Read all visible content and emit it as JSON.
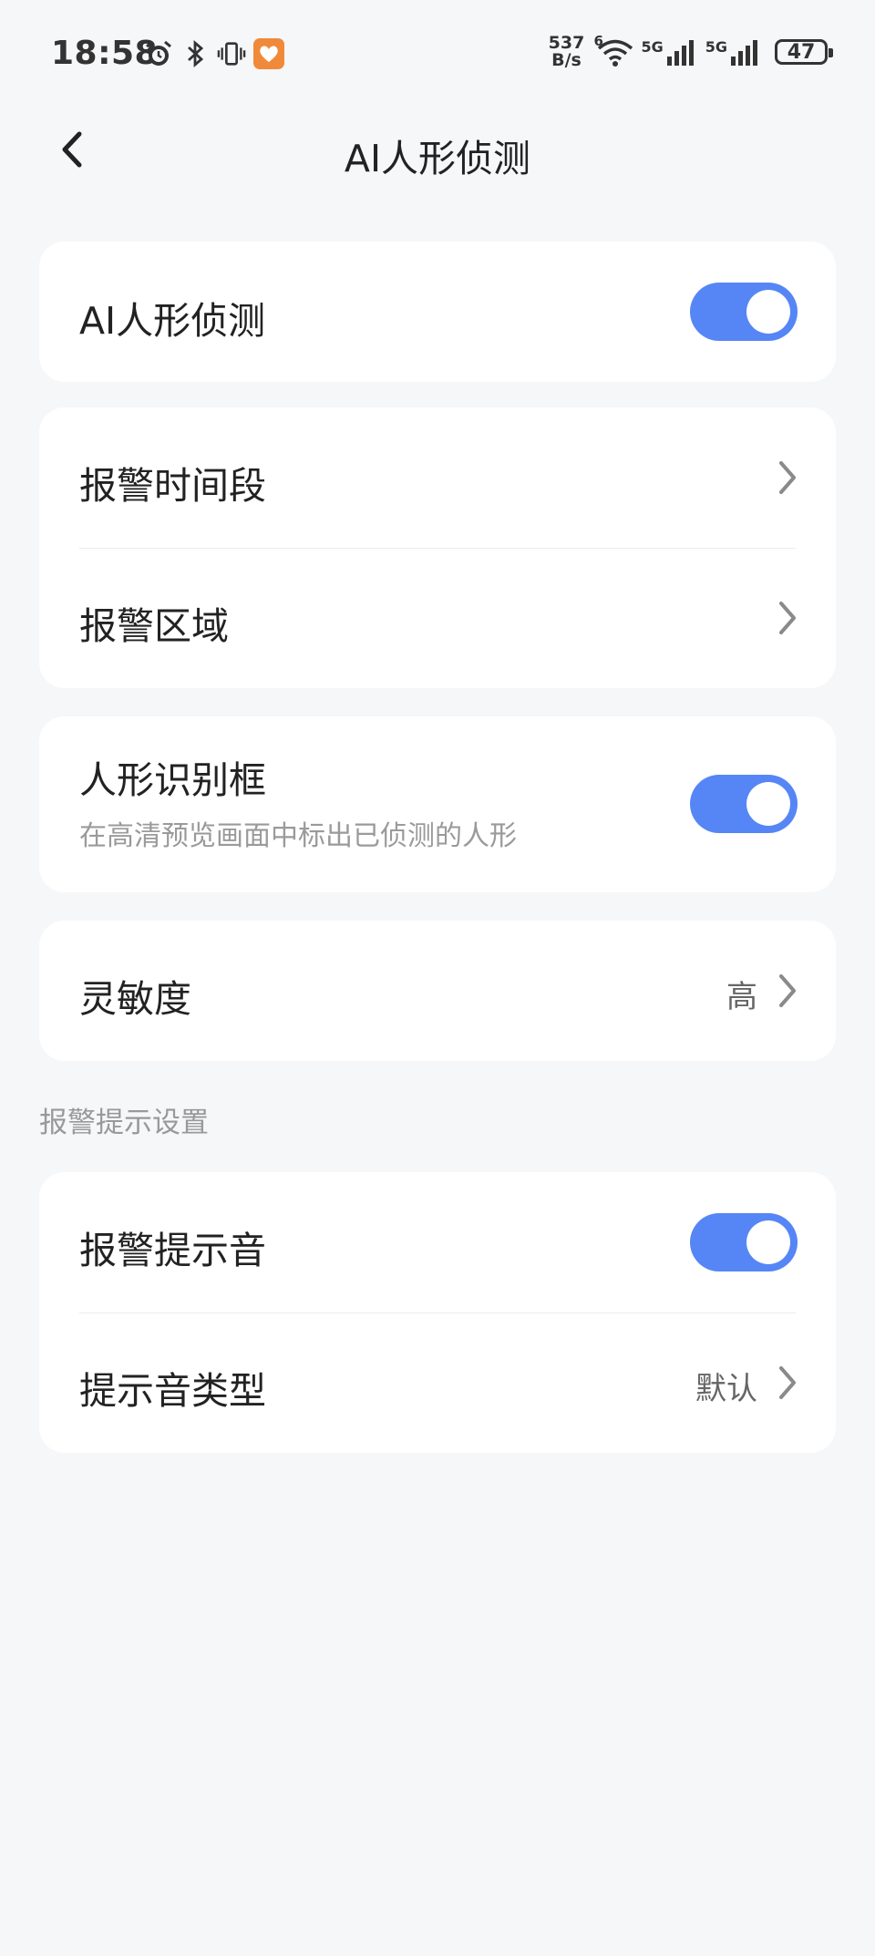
{
  "status_bar": {
    "time": "18:58",
    "speed_value": "537",
    "speed_unit": "B/s",
    "wifi_badge": "6",
    "net1": "5G",
    "net2": "5G",
    "battery": "47",
    "icons": [
      "alarm-icon",
      "bluetooth-icon",
      "vibrate-icon",
      "app-heart-icon",
      "wifi-icon",
      "signal-icon",
      "signal-icon",
      "battery-icon"
    ]
  },
  "header": {
    "title": "AI人形侦测"
  },
  "cards": {
    "ai_detect": {
      "label": "AI人形侦测",
      "enabled": true
    },
    "alarm": {
      "time_period": "报警时间段",
      "area": "报警区域"
    },
    "box": {
      "label": "人形识别框",
      "subtitle": "在高清预览画面中标出已侦测的人形",
      "enabled": true
    },
    "sensitivity": {
      "label": "灵敏度",
      "value": "高"
    },
    "alert_section": "报警提示设置",
    "sound": {
      "label": "报警提示音",
      "enabled": true
    },
    "sound_type": {
      "label": "提示音类型",
      "value": "默认"
    }
  },
  "colors": {
    "accent": "#5686f5",
    "background": "#f6f7f9",
    "card": "#ffffff"
  }
}
